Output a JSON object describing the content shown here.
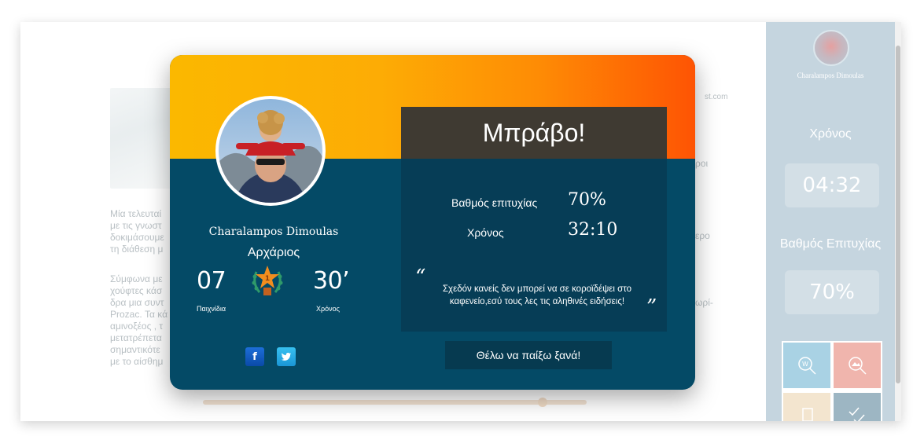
{
  "article": {
    "url_fragment": "st.com",
    "left_para_1": "Μία τελευταί\nμε τις γνωστ\nδοκιμάσουμε\nτη διάθεση μ",
    "left_para_2": "Σύμφωνα με\nχούφτες κάσ\nδρα μια συντ\nProzac. Τα κά\nαμινοξέος , τ\nμετατρέπετα\nσημαντικότε\nμε το αίσθημ",
    "right_frag_1": "ροι",
    "right_frag_2": "ερο",
    "right_frag_3": "ωρί-"
  },
  "sidebar": {
    "user_name": "Charalampos Dimoulas",
    "time_label": "Χρόνος",
    "time_value": "04:32",
    "score_label": "Βαθμός Επιτυχίας",
    "score_value": "70%",
    "tiles": [
      {
        "icon": "search-icon",
        "color": "#a9d2e4"
      },
      {
        "icon": "image-search-icon",
        "color": "#f0b5ad"
      },
      {
        "icon": "document-icon",
        "color": "#f3e5cf"
      },
      {
        "icon": "checkmarks-icon",
        "color": "#9db6c3"
      }
    ]
  },
  "modal": {
    "player": {
      "name": "Charalampos Dimoulas",
      "rank": "Αρχάριος",
      "games_value": "07",
      "games_label": "Παιχνίδια",
      "minutes_value": "30’",
      "minutes_label": "Χρόνος",
      "medal_icon": "star-medal-icon"
    },
    "social": {
      "facebook_glyph": "f",
      "twitter_icon": "twitter-bird-icon"
    },
    "results": {
      "title": "Μπράβο!",
      "score_label": "Βαθμός επιτυχίας",
      "score_value": "70%",
      "time_label": "Χρόνος",
      "time_value": "32:10",
      "quote_open": "“",
      "quote_text": "Σχεδόν κανείς δεν μπορεί να σε κοροϊδέψει στο καφενείο,εσύ τους λες τις αληθινές ειδήσεις!",
      "quote_close": "”"
    },
    "replay_label": "Θέλω να παίξω ξανά!"
  },
  "colors": {
    "header_gradient_start": "#fbb800",
    "header_gradient_end": "#fe5404",
    "modal_body": "#044a66",
    "sidebar_bg": "#c5d5df"
  }
}
